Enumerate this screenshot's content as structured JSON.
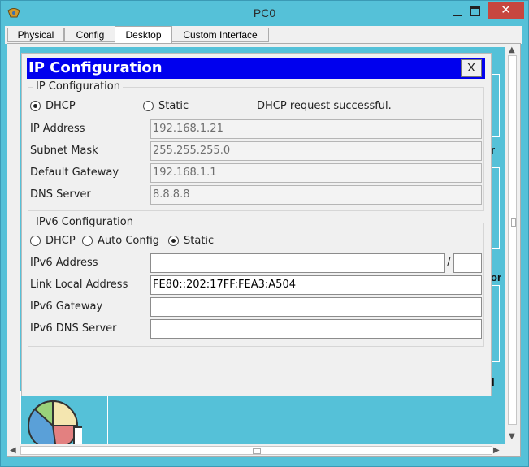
{
  "window": {
    "title": "PC0",
    "close_glyph": "✕"
  },
  "tabs": [
    {
      "label": "Physical"
    },
    {
      "label": "Config"
    },
    {
      "label": "Desktop"
    },
    {
      "label": "Custom Interface"
    }
  ],
  "active_tab": "Desktop",
  "background_peek": {
    "text_r": "r",
    "text_or": "or",
    "text_l": "l"
  },
  "dialog": {
    "title": "IP Configuration",
    "close_label": "X",
    "ipv4": {
      "legend": "IP Configuration",
      "mode_options": [
        {
          "label": "DHCP",
          "checked": true
        },
        {
          "label": "Static",
          "checked": false
        }
      ],
      "status": "DHCP request successful.",
      "fields": [
        {
          "label": "IP Address",
          "value": "192.168.1.21"
        },
        {
          "label": "Subnet Mask",
          "value": "255.255.255.0"
        },
        {
          "label": "Default Gateway",
          "value": "192.168.1.1"
        },
        {
          "label": "DNS Server",
          "value": "8.8.8.8"
        }
      ]
    },
    "ipv6": {
      "legend": "IPv6 Configuration",
      "mode_options": [
        {
          "label": "DHCP",
          "checked": false
        },
        {
          "label": "Auto Config",
          "checked": false
        },
        {
          "label": "Static",
          "checked": true
        }
      ],
      "prefix_separator": "/",
      "fields": [
        {
          "label": "IPv6 Address",
          "value": "",
          "prefix": ""
        },
        {
          "label": "Link Local Address",
          "value": "FE80::202:17FF:FEA3:A504"
        },
        {
          "label": "IPv6 Gateway",
          "value": ""
        },
        {
          "label": "IPv6 DNS Server",
          "value": ""
        }
      ]
    }
  },
  "colors": {
    "desktop_bg": "#55c1d8",
    "dialog_title_bg": "#0000ee",
    "close_button": "#c7463e"
  },
  "icons": {
    "app": "packet-tracer-icon",
    "pie": "pie-chart-icon"
  }
}
